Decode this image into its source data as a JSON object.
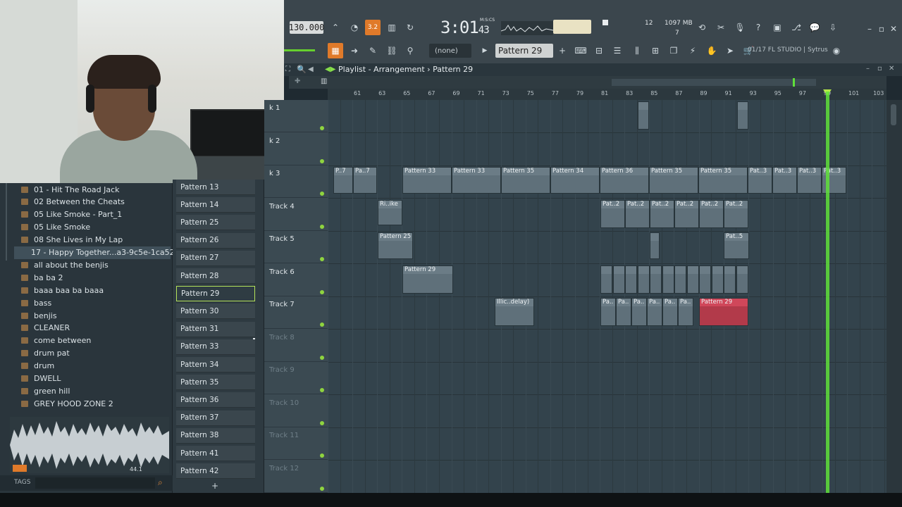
{
  "toolbar": {
    "tempo": "130.000",
    "time_main": "3:01",
    "time_sub": "43",
    "time_unit": "M:S:CS",
    "cpu_voices": "12",
    "memory": "1097 MB",
    "mem_sub": "7",
    "pattern_selector": "Pattern 29",
    "snap_none": "(none)",
    "hint_text": "01/17  FL STUDIO | Sytrus",
    "step_label": "3.2"
  },
  "playlist": {
    "title": "Playlist - Arrangement",
    "pattern": "Pattern 29",
    "ruler_ticks": [
      "61",
      "63",
      "65",
      "67",
      "69",
      "71",
      "73",
      "75",
      "77",
      "79",
      "81",
      "83",
      "85",
      "87",
      "89",
      "91",
      "93",
      "95",
      "97",
      "99",
      "101",
      "103"
    ],
    "tracks": [
      {
        "label": "k 1",
        "dim": false
      },
      {
        "label": "k 2",
        "dim": false
      },
      {
        "label": "k 3",
        "dim": false
      },
      {
        "label": "Track 4",
        "dim": false
      },
      {
        "label": "Track 5",
        "dim": false
      },
      {
        "label": "Track 6",
        "dim": false
      },
      {
        "label": "Track 7",
        "dim": false
      },
      {
        "label": "Track 8",
        "dim": true
      },
      {
        "label": "Track 9",
        "dim": true
      },
      {
        "label": "Track 10",
        "dim": true
      },
      {
        "label": "Track 11",
        "dim": true
      },
      {
        "label": "Track 12",
        "dim": true
      }
    ],
    "clips": {
      "t3": [
        "P..7",
        "Pa..7",
        "Pattern 33",
        "Pattern 33",
        "Pattern 35",
        "Pattern 34",
        "Pattern 36",
        "Pattern 35",
        "Pattern 35",
        "Pat..3",
        "Pat..3",
        "Pat..3",
        "Pat..3"
      ],
      "t4a": "Ri..ike",
      "t4b": [
        "Pat..2",
        "Pat..2",
        "Pat..2",
        "Pat..2",
        "Pat..2",
        "Pat..2"
      ],
      "t5a": "Pattern 25",
      "t5b": "Pat..5",
      "t6": "Pattern 29",
      "t7a": "Illic..delay)",
      "t7b": [
        "Pa..",
        "Pa..",
        "Pa..",
        "Pa..",
        "Pa..",
        "Pa.."
      ],
      "t7c": "Pattern 29"
    }
  },
  "browser": {
    "items": [
      "01 - Hit The Road Jack",
      "02 Between the Cheats",
      "05 Like Smoke - Part_1",
      "05 Like Smoke",
      "08 She Lives in My Lap",
      "17 - Happy Together...a3-9c5e-1ca52f373584",
      "all about the benjis",
      "ba ba 2",
      "baaa baa ba baaa",
      "bass",
      "benjis",
      "CLEANER",
      "come between",
      "drum pat",
      "drum",
      "DWELL",
      "green hill",
      "GREY HOOD ZONE 2"
    ],
    "active_index": 5,
    "sample_rate": "44.1",
    "tags_label": "TAGS"
  },
  "channels": {
    "items": [
      "Pattern 13",
      "Pattern 14",
      "Pattern 25",
      "Pattern 26",
      "Pattern 27",
      "Pattern 28",
      "Pattern 29",
      "Pattern 30",
      "Pattern 31",
      "Pattern 33",
      "Pattern 34",
      "Pattern 35",
      "Pattern 36",
      "Pattern 37",
      "Pattern 38",
      "Pattern 41",
      "Pattern 42"
    ],
    "selected_index": 6
  },
  "colors": {
    "accent_green": "#5fe03a",
    "selected_clip": "#d0475a",
    "toolbar_bg": "#3b464d"
  }
}
